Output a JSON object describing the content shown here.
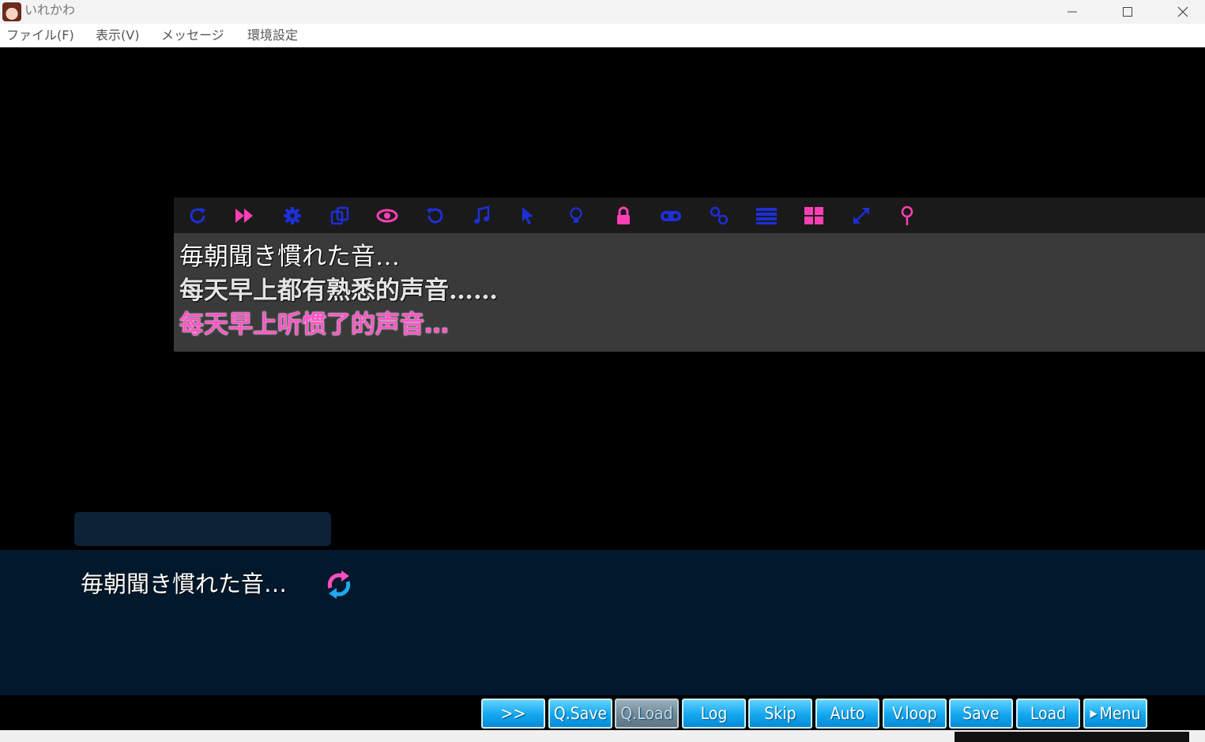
{
  "window": {
    "title": "いれかわ",
    "controls": {
      "minimize": "—",
      "maximize": "☐",
      "close": "✕"
    }
  },
  "menubar": {
    "items": [
      "ファイル(F)",
      "表示(V)",
      "メッセージ",
      "環境設定"
    ]
  },
  "overlay": {
    "toolbar_icons": [
      {
        "name": "refresh",
        "color": "#1d2fd6"
      },
      {
        "name": "fast-forward",
        "color": "#ff3fb4"
      },
      {
        "name": "settings",
        "color": "#1d2fd6"
      },
      {
        "name": "copy",
        "color": "#1d2fd6"
      },
      {
        "name": "eye",
        "color": "#ff3fb4"
      },
      {
        "name": "undo",
        "color": "#1d2fd6"
      },
      {
        "name": "music",
        "color": "#1d2fd6"
      },
      {
        "name": "cursor",
        "color": "#1d2fd6"
      },
      {
        "name": "bulb",
        "color": "#1d2fd6"
      },
      {
        "name": "lock",
        "color": "#ff3fb4"
      },
      {
        "name": "gamepad",
        "color": "#1d2fd6"
      },
      {
        "name": "link",
        "color": "#1d2fd6"
      },
      {
        "name": "list",
        "color": "#1d2fd6"
      },
      {
        "name": "windows",
        "color": "#ff3fb4"
      },
      {
        "name": "expand",
        "color": "#1d2fd6"
      },
      {
        "name": "pin",
        "color": "#ff3fb4"
      }
    ],
    "lines": {
      "original": "毎朝聞き慣れた音…",
      "translation_1": "每天早上都有熟悉的声音……",
      "translation_2": "每天早上听惯了的声音…"
    }
  },
  "message": {
    "name": "",
    "text": "毎朝聞き慣れた音…"
  },
  "buttons": [
    {
      "label": ">>",
      "disabled": false
    },
    {
      "label": "Q.Save",
      "disabled": false
    },
    {
      "label": "Q.Load",
      "disabled": true
    },
    {
      "label": "Log",
      "disabled": false
    },
    {
      "label": "Skip",
      "disabled": false
    },
    {
      "label": "Auto",
      "disabled": false
    },
    {
      "label": "V.loop",
      "disabled": false
    },
    {
      "label": "Save",
      "disabled": false
    },
    {
      "label": "Load",
      "disabled": false
    },
    {
      "label": "Menu",
      "disabled": false
    }
  ],
  "colors": {
    "overlay_pink": "#ff56c6",
    "icon_blue": "#1d2fd6",
    "button_blue": "#12a6ee",
    "message_bg": "#02182c"
  }
}
